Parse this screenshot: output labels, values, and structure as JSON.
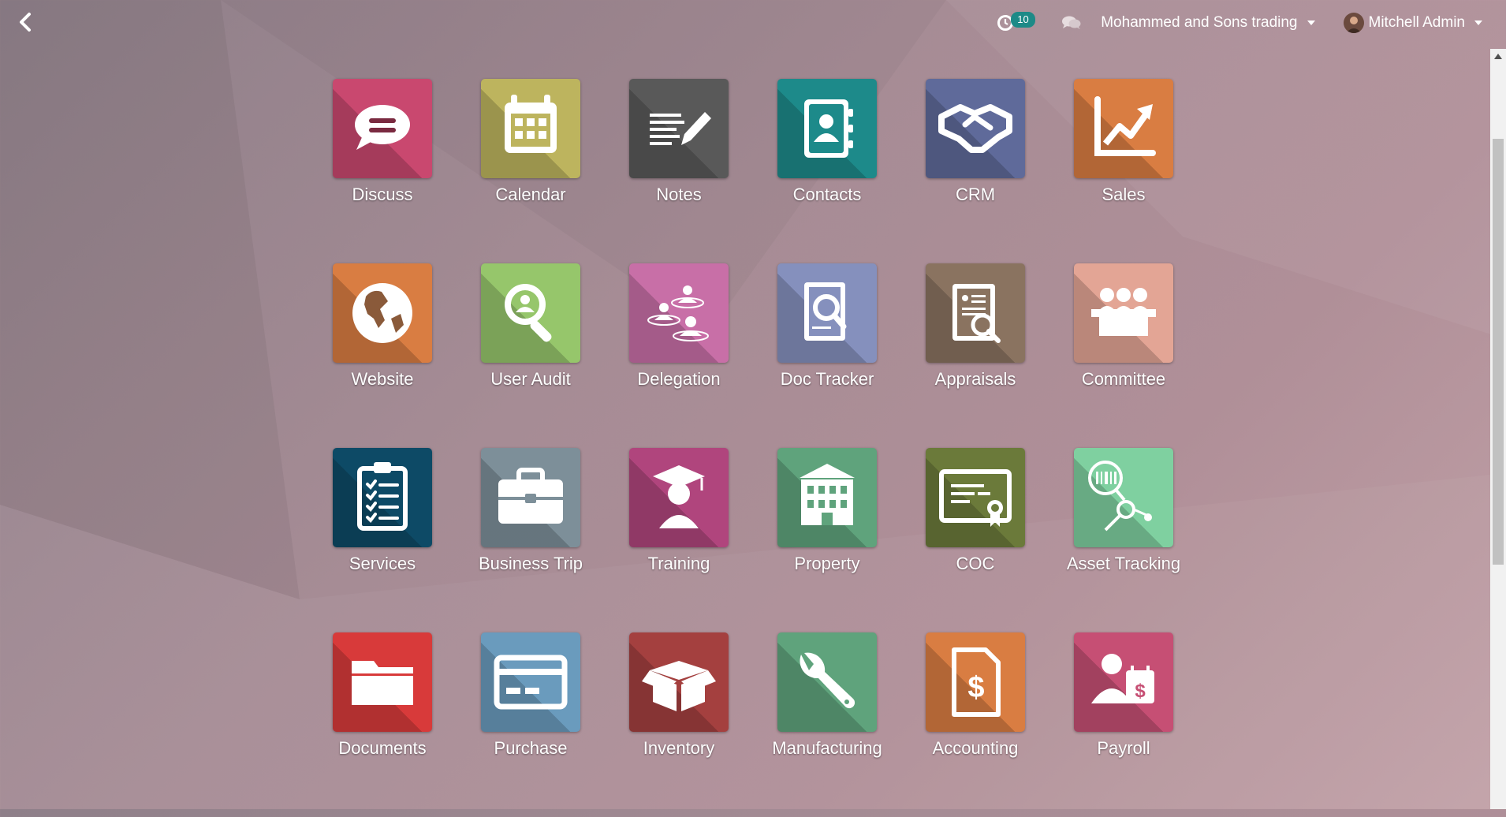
{
  "topbar": {
    "activity_count": "10",
    "company": "Mohammed and Sons trading",
    "user": "Mitchell Admin"
  },
  "apps": [
    {
      "label": "Discuss",
      "color": "#c9486f",
      "icon": "chat-bubble-icon"
    },
    {
      "label": "Calendar",
      "color": "#bdb45e",
      "icon": "calendar-icon"
    },
    {
      "label": "Notes",
      "color": "#595959",
      "icon": "notes-pencil-icon"
    },
    {
      "label": "Contacts",
      "color": "#1d8a8a",
      "icon": "address-book-icon"
    },
    {
      "label": "CRM",
      "color": "#5f6a9a",
      "icon": "handshake-icon"
    },
    {
      "label": "Sales",
      "color": "#d97d42",
      "icon": "trend-chart-icon"
    },
    {
      "label": "Website",
      "color": "#d97d42",
      "icon": "globe-icon"
    },
    {
      "label": "User Audit",
      "color": "#96c66b",
      "icon": "user-search-icon"
    },
    {
      "label": "Delegation",
      "color": "#c86fa7",
      "icon": "delegation-users-icon"
    },
    {
      "label": "Doc Tracker",
      "color": "#8590bd",
      "icon": "document-search-icon"
    },
    {
      "label": "Appraisals",
      "color": "#8a7360",
      "icon": "appraisal-report-icon"
    },
    {
      "label": "Committee",
      "color": "#e3a595",
      "icon": "committee-table-icon"
    },
    {
      "label": "Services",
      "color": "#0d4a66",
      "icon": "checklist-clipboard-icon"
    },
    {
      "label": "Business Trip",
      "color": "#7d8f99",
      "icon": "briefcase-icon"
    },
    {
      "label": "Training",
      "color": "#b0457d",
      "icon": "graduate-icon"
    },
    {
      "label": "Property",
      "color": "#5fa37c",
      "icon": "building-icon"
    },
    {
      "label": "COC",
      "color": "#6b7a3a",
      "icon": "certificate-icon"
    },
    {
      "label": "Asset Tracking",
      "color": "#7fd0a0",
      "icon": "barcode-tracking-icon"
    },
    {
      "label": "Documents",
      "color": "#d83a3a",
      "icon": "folder-icon"
    },
    {
      "label": "Purchase",
      "color": "#6a9bbd",
      "icon": "credit-card-icon"
    },
    {
      "label": "Inventory",
      "color": "#a4403f",
      "icon": "box-icon"
    },
    {
      "label": "Manufacturing",
      "color": "#5fa37c",
      "icon": "wrench-icon"
    },
    {
      "label": "Accounting",
      "color": "#d97d42",
      "icon": "invoice-dollar-icon"
    },
    {
      "label": "Payroll",
      "color": "#c64f74",
      "icon": "payroll-icon"
    }
  ]
}
